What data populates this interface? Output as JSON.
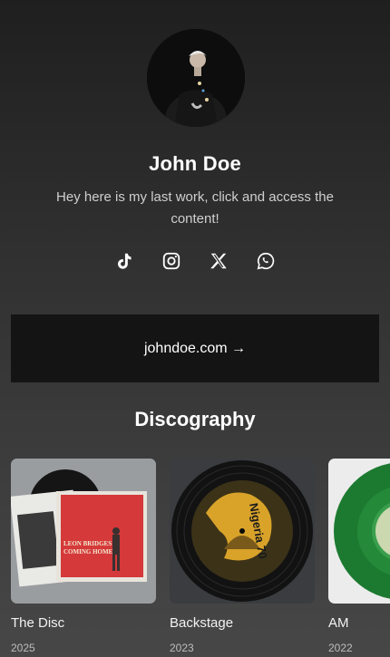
{
  "profile": {
    "name": "John Doe",
    "bio": "Hey here is my last work, click and access the content!"
  },
  "socials": [
    {
      "icon": "tiktok-icon"
    },
    {
      "icon": "instagram-icon"
    },
    {
      "icon": "x-icon"
    },
    {
      "icon": "whatsapp-icon"
    }
  ],
  "link": {
    "label": "johndoe.com →"
  },
  "discography": {
    "title": "Discography",
    "albums": [
      {
        "title": "The Disc",
        "year": "2025",
        "cover_text_1": "LEON BRIDGES",
        "cover_text_2": "COMING HOME"
      },
      {
        "title": "Backstage",
        "year": "2023",
        "cover_text_1": "Nigeria 70"
      },
      {
        "title": "AM",
        "year": "2022"
      }
    ]
  },
  "colors": {
    "background_top": "#1f1f1f",
    "background_bottom": "#474747",
    "card": "#141414",
    "text": "#ffffff",
    "muted_text": "#cfcfcf"
  }
}
